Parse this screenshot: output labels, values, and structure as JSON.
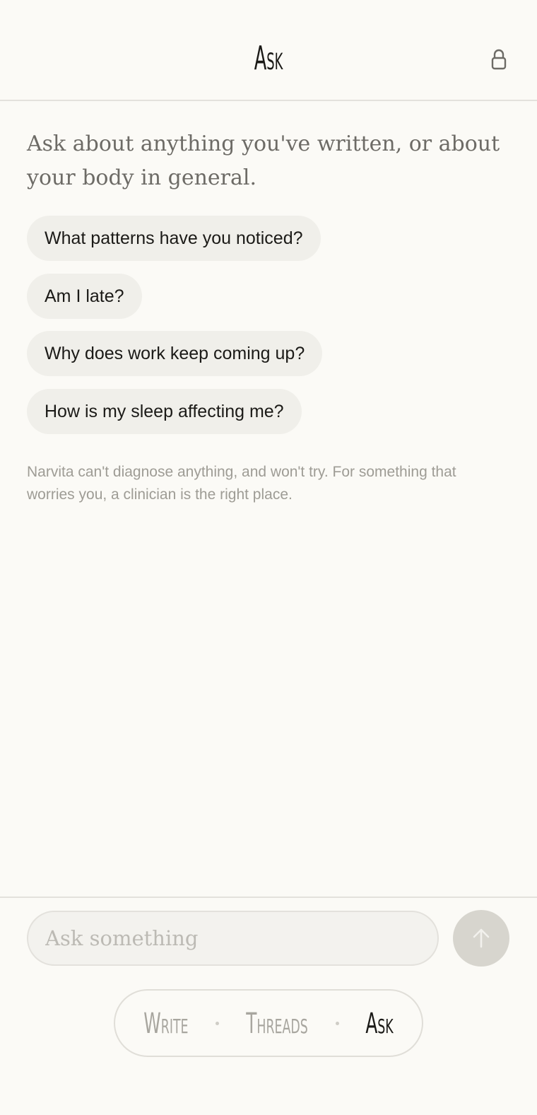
{
  "header": {
    "title": "Ask",
    "lock_icon": "lock-icon"
  },
  "intro": {
    "text": "Ask about anything you've written, or about your body in general."
  },
  "suggestions": [
    {
      "label": "What patterns have you noticed?"
    },
    {
      "label": "Am I late?"
    },
    {
      "label": "Why does work keep coming up?"
    },
    {
      "label": "How is my sleep affecting me?"
    }
  ],
  "disclaimer": {
    "text": "Narvita can't diagnose anything, and won't try. For something that worries you, a clinician is the right place."
  },
  "composer": {
    "placeholder": "Ask something",
    "value": "",
    "send_icon": "arrow-up-icon"
  },
  "nav": {
    "items": [
      {
        "label": "Write",
        "active": false
      },
      {
        "label": "Threads",
        "active": false
      },
      {
        "label": "Ask",
        "active": true
      }
    ],
    "separator": "·"
  },
  "colors": {
    "background": "#fbfaf6",
    "chip": "#f0efea",
    "muted_text": "#9e9c95",
    "send_button": "#d7d5ce"
  }
}
